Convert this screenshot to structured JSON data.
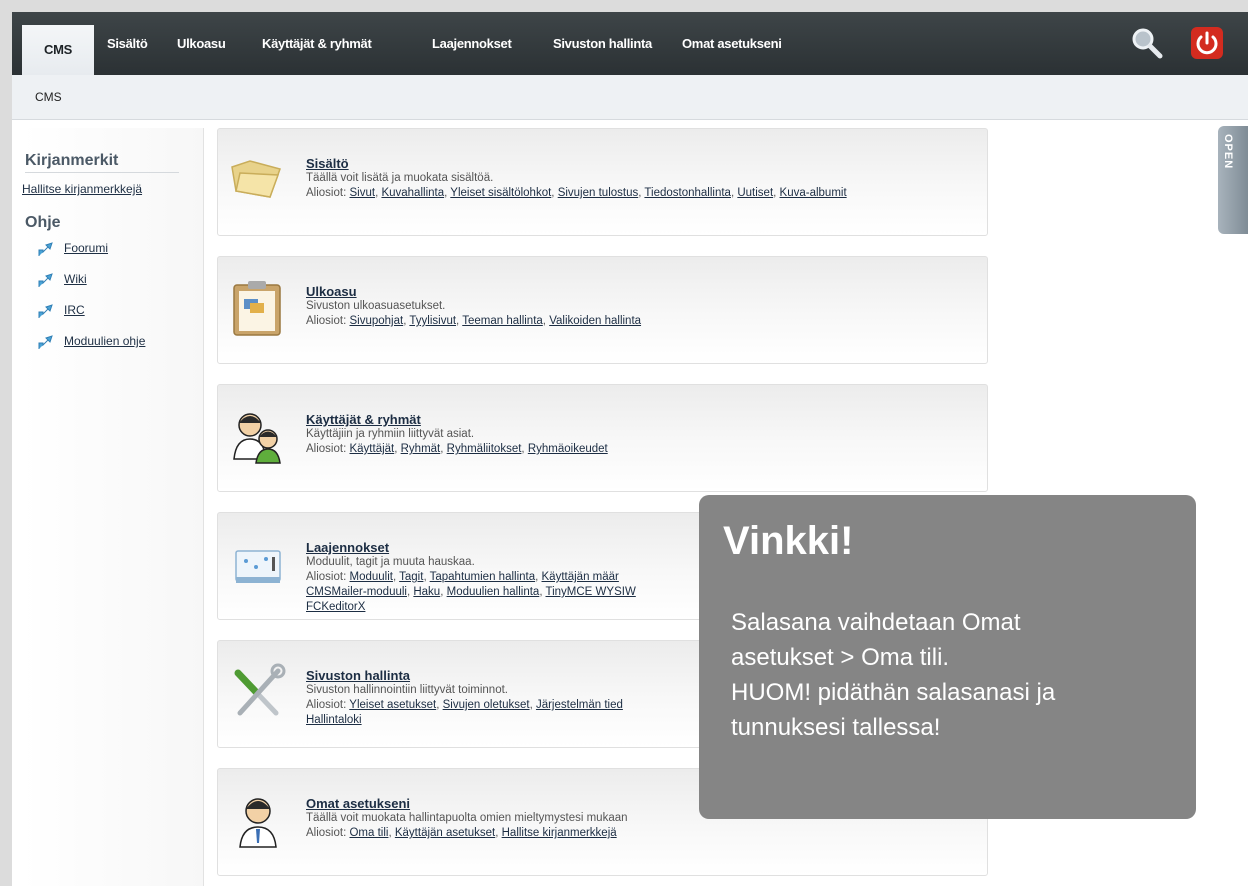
{
  "nav": {
    "tabs": [
      "CMS",
      "Sisältö",
      "Ulkoasu",
      "Käyttäjät & ryhmät",
      "Laajennokset",
      "Sivuston hallinta",
      "Omat asetukseni"
    ],
    "active": "CMS"
  },
  "breadcrumb": "CMS",
  "sidebar": {
    "bookmarks_title": "Kirjanmerkit",
    "manage_bookmarks": "Hallitse kirjanmerkkejä",
    "help_title": "Ohje",
    "help_items": [
      "Foorumi",
      "Wiki",
      "IRC",
      "Moduulien ohje"
    ]
  },
  "panels": [
    {
      "title": "Sisältö",
      "desc": "Täällä voit lisätä ja muokata sisältöä.",
      "sub_prefix": "Aliosiot:",
      "links": [
        "Sivut",
        "Kuvahallinta",
        "Yleiset sisältölohkot",
        "Sivujen tulostus",
        "Tiedostonhallinta",
        "Uutiset",
        "Kuva-albumit"
      ],
      "icon": "folder-icon"
    },
    {
      "title": "Ulkoasu",
      "desc": "Sivuston ulkoasuasetukset.",
      "sub_prefix": "Aliosiot:",
      "links": [
        "Sivupohjat",
        "Tyylisivut",
        "Teeman hallinta",
        "Valikoiden hallinta"
      ],
      "icon": "clipboard-icon"
    },
    {
      "title": "Käyttäjät & ryhmät",
      "desc": "Käyttäjiin ja ryhmiin liittyvät asiat.",
      "sub_prefix": "Aliosiot:",
      "links": [
        "Käyttäjät",
        "Ryhmät",
        "Ryhmäliitokset",
        "Ryhmäoikeudet"
      ],
      "icon": "users-icon"
    },
    {
      "title": "Laajennokset",
      "desc": "Moduulit, tagit ja muuta hauskaa.",
      "sub_prefix": "Aliosiot:",
      "links": [
        "Moduulit",
        "Tagit",
        "Tapahtumien hallinta",
        "Käyttäjän määr",
        "CMSMailer-moduuli",
        "Haku",
        "Moduulien hallinta",
        "TinyMCE WYSIW",
        "FCKeditorX"
      ],
      "icon": "extensions-icon"
    },
    {
      "title": "Sivuston hallinta",
      "desc": "Sivuston hallinnointiin liittyvät toiminnot.",
      "sub_prefix": "Aliosiot:",
      "links": [
        "Yleiset asetukset",
        "Sivujen oletukset",
        "Järjestelmän tied",
        "Hallintaloki"
      ],
      "icon": "tools-icon"
    },
    {
      "title": "Omat asetukseni",
      "desc": "Täällä voit muokata hallintapuolta omien mieltymystesi mukaan",
      "sub_prefix": "Aliosiot:",
      "links": [
        "Oma tili",
        "Käyttäjän asetukset",
        "Hallitse kirjanmerkkejä"
      ],
      "icon": "user-icon"
    }
  ],
  "open_tab": "OPEN",
  "tip": {
    "title": "Vinkki!",
    "lines": [
      "Salasana vaihdetaan Omat",
      "asetukset > Oma tili.",
      "HUOM! pidäthän salasanasi ja",
      "tunnuksesi tallessa!"
    ]
  },
  "colors": {
    "nav_bg": "#2f3538",
    "tip_bg": "#858585",
    "power": "#d32b1f"
  }
}
